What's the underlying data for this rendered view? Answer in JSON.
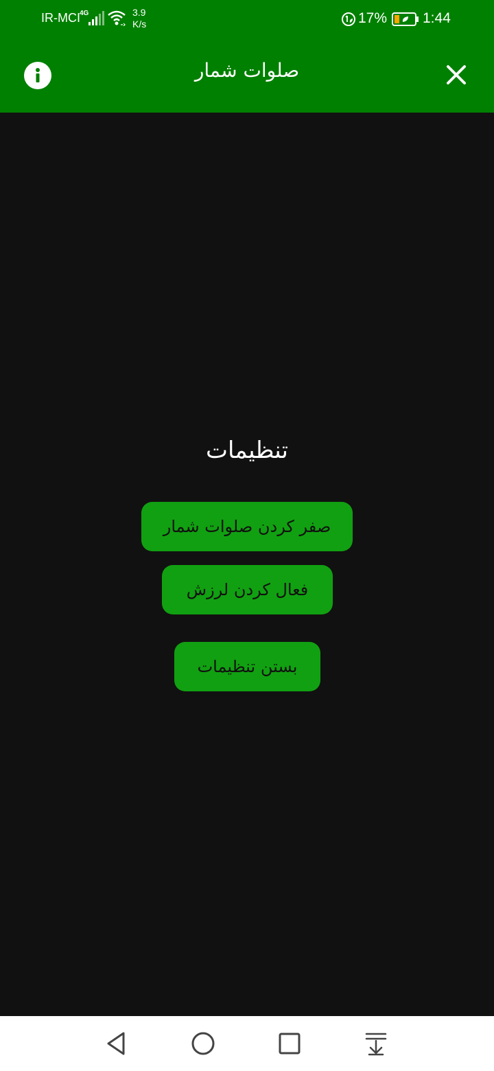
{
  "status_bar": {
    "carrier": "IR-MCI",
    "network_type": "4G",
    "speed_value": "3.9",
    "speed_unit": "K/s",
    "battery_percent": "17%",
    "time": "1:44"
  },
  "app_bar": {
    "title": "صلوات شمار",
    "info_icon": "info-icon",
    "close_icon": "close-icon"
  },
  "settings": {
    "title": "تنظیمات",
    "reset_counter_label": "صفر کردن صلوات شمار",
    "enable_vibration_label": "فعال کردن لرزش",
    "close_settings_label": "بستن تنظیمات"
  },
  "nav_bar": {
    "icons": [
      "back-icon",
      "home-icon",
      "recents-icon",
      "notification-pull-icon"
    ]
  },
  "colors": {
    "app_bar": "#008000",
    "background": "#111111",
    "button": "#11a011",
    "nav_bar": "#ffffff"
  }
}
